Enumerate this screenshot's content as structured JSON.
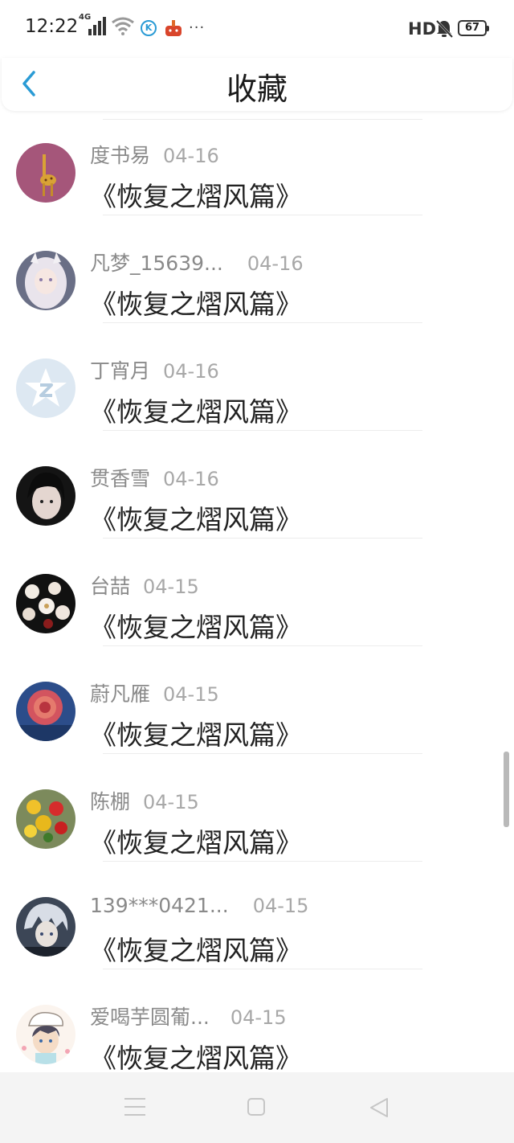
{
  "status": {
    "time": "12:22",
    "network": "4G",
    "hd": "HD",
    "battery": "67"
  },
  "header": {
    "title": "收藏"
  },
  "items": [
    {
      "name": "度书易",
      "date": "04-16",
      "book": "《恢复之熠风篇》",
      "avatar": "giraffe"
    },
    {
      "name": "凡梦_15639...",
      "date": "04-16",
      "book": "《恢复之熠风篇》",
      "avatar": "anime-girl"
    },
    {
      "name": "丁宵月",
      "date": "04-16",
      "book": "《恢复之熠风篇》",
      "avatar": "default-star"
    },
    {
      "name": "贯香雪",
      "date": "04-16",
      "book": "《恢复之熠风篇》",
      "avatar": "dark-girl"
    },
    {
      "name": "台喆",
      "date": "04-15",
      "book": "《恢复之熠风篇》",
      "avatar": "flowers-dark"
    },
    {
      "name": "蔚凡雁",
      "date": "04-15",
      "book": "《恢复之熠风篇》",
      "avatar": "rose"
    },
    {
      "name": "陈棚",
      "date": "04-15",
      "book": "《恢复之熠风篇》",
      "avatar": "bouquet"
    },
    {
      "name": "139***0421...",
      "date": "04-15",
      "book": "《恢复之熠风篇》",
      "avatar": "anime-boy"
    },
    {
      "name": "爱喝芋圆葡...",
      "date": "04-15",
      "book": "《恢复之熠风篇》",
      "avatar": "cartoon-chef"
    }
  ],
  "colors": {
    "accent": "#2a9bd5",
    "name": "#8a8a8a",
    "date": "#a8a8a8",
    "title": "#1a1a1a"
  }
}
